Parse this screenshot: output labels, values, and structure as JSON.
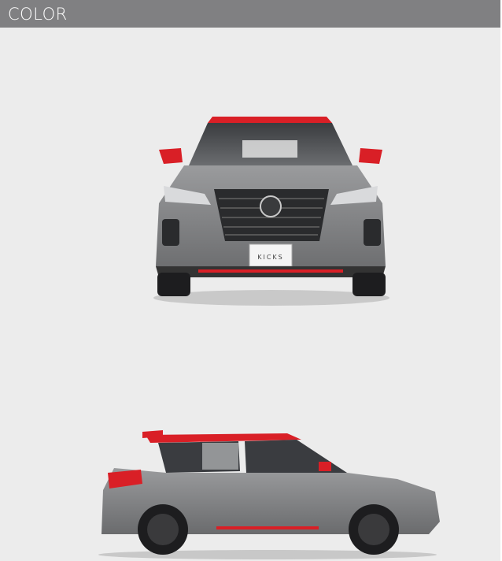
{
  "section": {
    "title": "COLOR"
  },
  "vehicle": {
    "front_plate": "KICKS",
    "body_color": "#8a8b8d",
    "accent_color": "#d91f26",
    "views": [
      "front-view",
      "side-view"
    ]
  }
}
